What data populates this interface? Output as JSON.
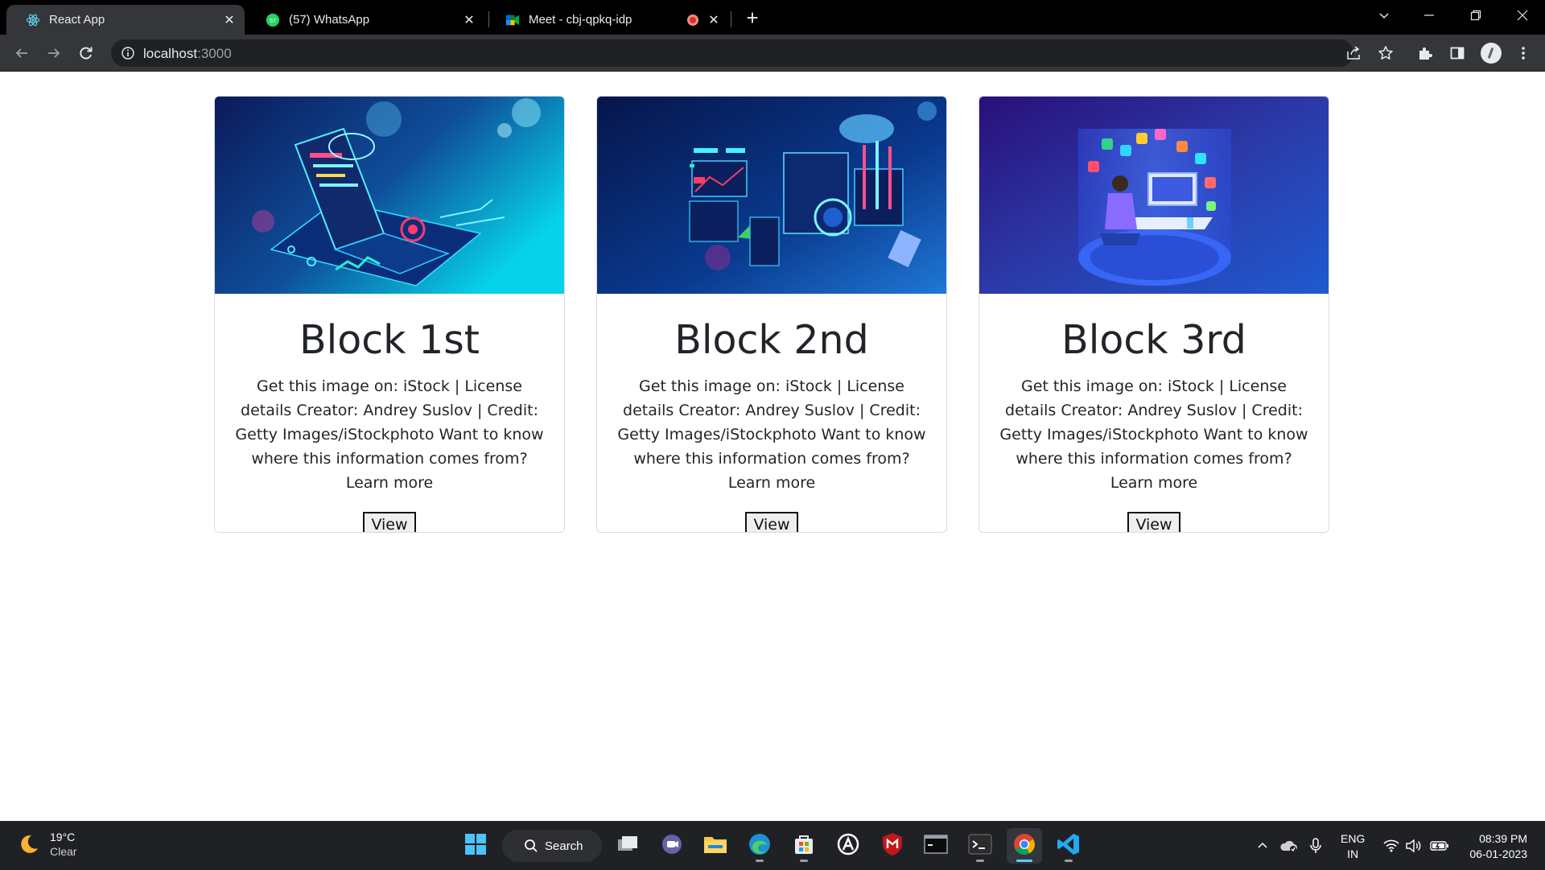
{
  "browser": {
    "tabs": [
      {
        "title": "React App",
        "active": true
      },
      {
        "title": "(57) WhatsApp",
        "badge": "57"
      },
      {
        "title": "Meet - cbj-qpkq-idp",
        "recording": true
      }
    ],
    "new_tab": "+",
    "address": {
      "host": "localhost",
      "port": ":3000"
    }
  },
  "cards": [
    {
      "title": "Block 1st",
      "text": "Get this image on: iStock | License details Creator: Andrey Suslov | Credit: Getty Images/iStockphoto Want to know where this information comes from? Learn more",
      "button": "View",
      "image": "laptop-cloud-network-illustration"
    },
    {
      "title": "Block 2nd",
      "text": "Get this image on: iStock | License details Creator: Andrey Suslov | Credit: Getty Images/iStockphoto Want to know where this information comes from? Learn more",
      "button": "View",
      "image": "data-center-dashboards-illustration"
    },
    {
      "title": "Block 3rd",
      "text": "Get this image on: iStock | License details Creator: Andrey Suslov | Credit: Getty Images/iStockphoto Want to know where this information comes from? Learn more",
      "button": "View",
      "image": "developer-workstation-isometric-illustration"
    }
  ],
  "taskbar": {
    "weather": {
      "temp": "19°C",
      "condition": "Clear"
    },
    "search_label": "Search",
    "lang": {
      "line1": "ENG",
      "line2": "IN"
    },
    "clock": {
      "time": "08:39 PM",
      "date": "06-01-2023"
    }
  },
  "colors": {
    "tabstrip": "#000000",
    "toolbar": "#35363a",
    "omnibox": "#202124",
    "taskbar": "#1f2125",
    "accent": "#60cdff"
  }
}
